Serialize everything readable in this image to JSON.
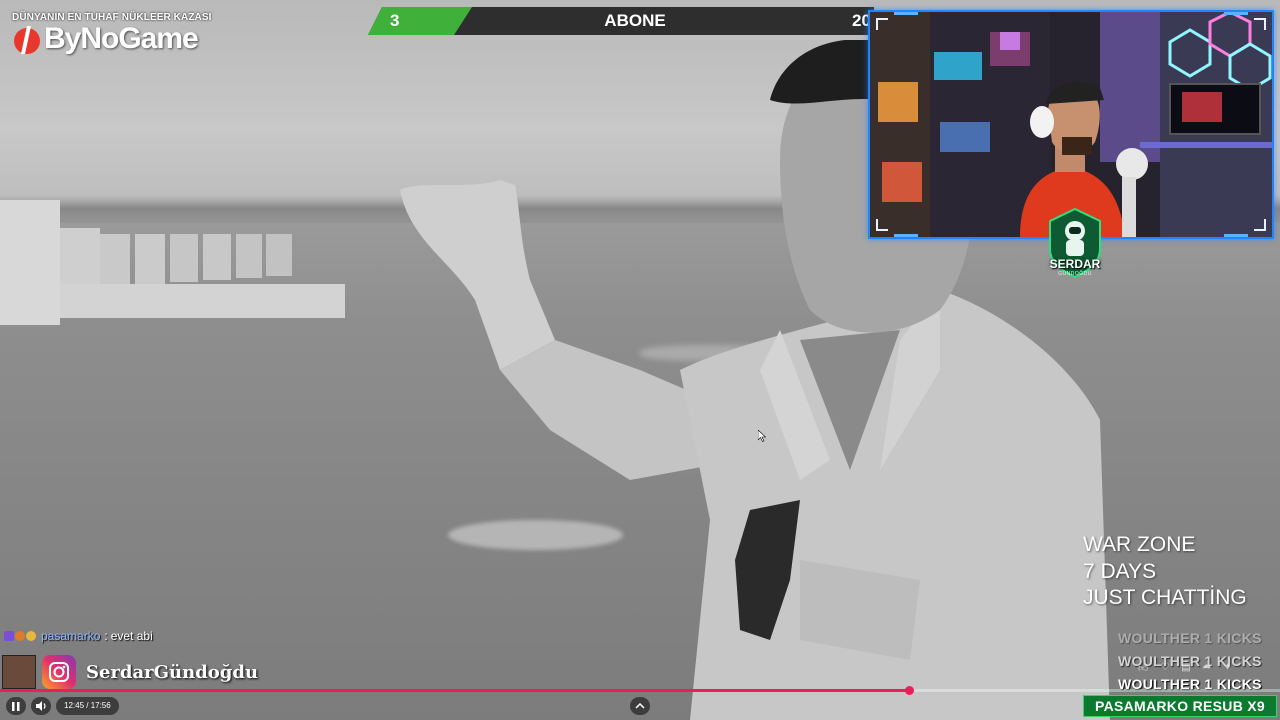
{
  "branding": {
    "subtitle": "DÜNYANIN EN TUHAF NÜKLEER KAZASI",
    "name": "ByNoGame",
    "logo_icon": "bynogame-logo-icon"
  },
  "goal_bar": {
    "current": "3",
    "label": "ABONE",
    "target": "20",
    "progress": 0.15,
    "fill_color": "#3fb13a"
  },
  "webcam": {
    "streamer_name": "SERDAR",
    "streamer_sub": "GÜNDOĞDU",
    "border_color": "#1f86ff"
  },
  "info_text": [
    "WAR ZONE",
    "7 DAYS",
    "JUST CHATTİNG"
  ],
  "alerts": {
    "kicks": [
      "WOULTHER  1 KICKS",
      "WOULTHER  1 KICKS",
      "WOULTHER  1 KICKS"
    ],
    "resub": "PASAMARKO  RESUB X9",
    "resub_color": "#0c7a2e"
  },
  "chat": {
    "username": "pasamarko",
    "separator": ":",
    "message": "evet abi"
  },
  "social": {
    "handle": "SerdarGündoğdu",
    "icon": "instagram-icon"
  },
  "player": {
    "time": "12:45 / 17:56",
    "progress": 0.7098,
    "accent": "#e91f5a",
    "play_state_icon": "pause-icon",
    "volume_icon": "volume-icon",
    "expand_icon": "chevron-up-icon"
  }
}
